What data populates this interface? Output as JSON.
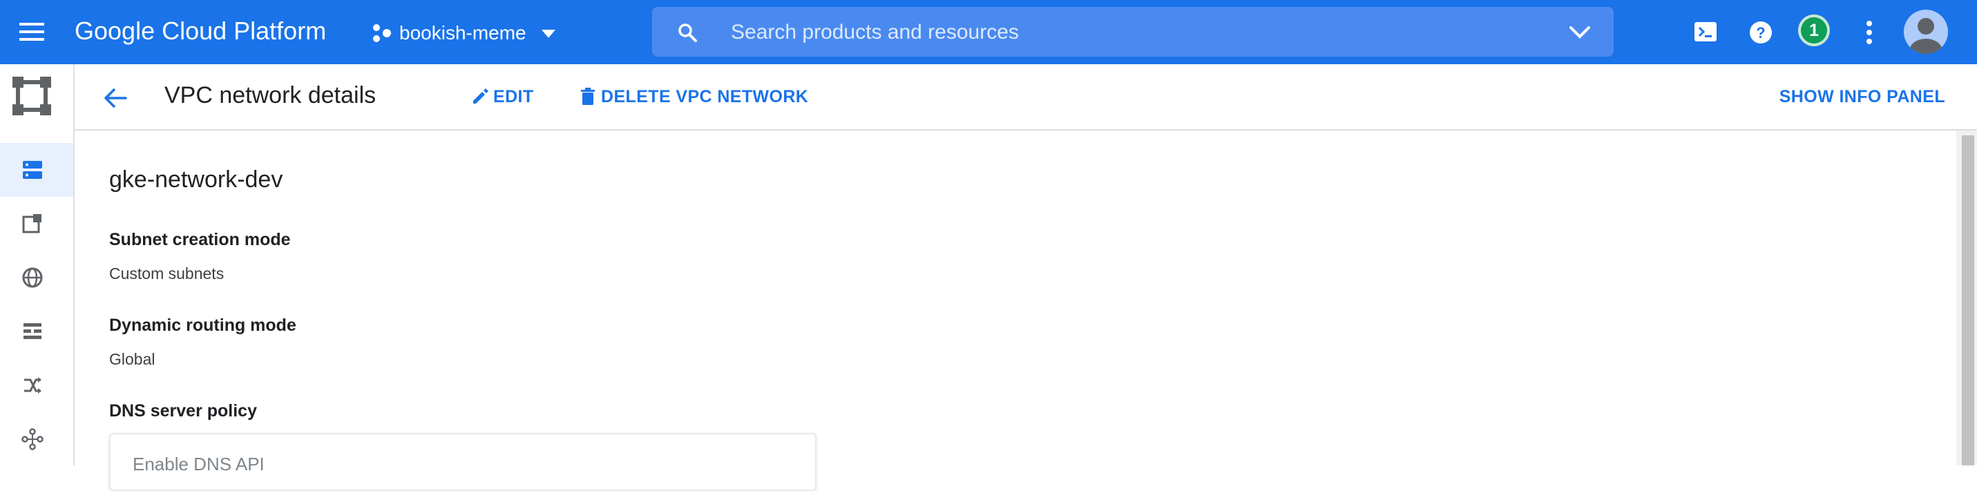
{
  "topbar": {
    "brand": "Google Cloud Platform",
    "project": "bookish-meme",
    "search_placeholder": "Search products and resources",
    "notification_count": "1"
  },
  "header": {
    "title": "VPC network details",
    "edit_label": "EDIT",
    "delete_label": "DELETE VPC NETWORK",
    "info_panel_label": "SHOW INFO PANEL"
  },
  "network": {
    "name": "gke-network-dev",
    "fields": [
      {
        "label": "Subnet creation mode",
        "value": "Custom subnets"
      },
      {
        "label": "Dynamic routing mode",
        "value": "Global"
      }
    ],
    "dns_label": "DNS server policy",
    "dns_card_text": "Enable DNS API"
  },
  "rail": {
    "items": [
      {
        "icon": "vpc-networks-icon",
        "active": true
      },
      {
        "icon": "external-ip-icon",
        "active": false
      },
      {
        "icon": "globe-icon",
        "active": false
      },
      {
        "icon": "firewall-icon",
        "active": false
      },
      {
        "icon": "routes-icon",
        "active": false
      },
      {
        "icon": "peering-icon",
        "active": false
      }
    ]
  },
  "colors": {
    "primary": "#1a73e8",
    "search_bg": "#4a8af0",
    "badge": "#0f9d58",
    "active_rail": "#e8f0fe"
  }
}
